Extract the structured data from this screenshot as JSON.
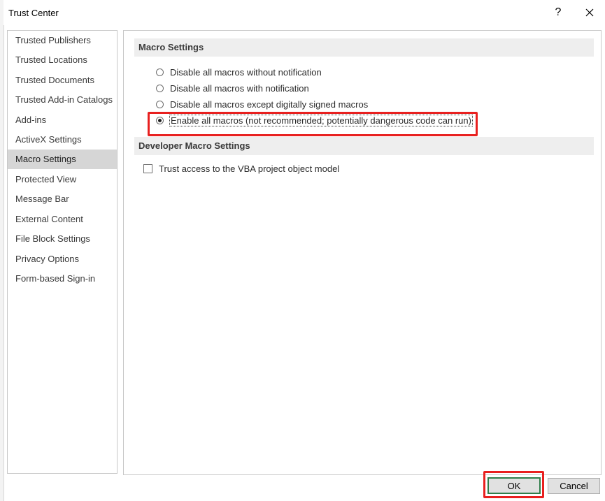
{
  "window": {
    "title": "Trust Center",
    "help_label": "?"
  },
  "sidebar": {
    "items": [
      {
        "label": "Trusted Publishers"
      },
      {
        "label": "Trusted Locations"
      },
      {
        "label": "Trusted Documents"
      },
      {
        "label": "Trusted Add-in Catalogs"
      },
      {
        "label": "Add-ins"
      },
      {
        "label": "ActiveX Settings"
      },
      {
        "label": "Macro Settings"
      },
      {
        "label": "Protected View"
      },
      {
        "label": "Message Bar"
      },
      {
        "label": "External Content"
      },
      {
        "label": "File Block Settings"
      },
      {
        "label": "Privacy Options"
      },
      {
        "label": "Form-based Sign-in"
      }
    ],
    "active_item": "Macro Settings"
  },
  "macro_settings": {
    "header": "Macro Settings",
    "options": [
      {
        "label": "Disable all macros without notification",
        "checked": false
      },
      {
        "label": "Disable all macros with notification",
        "checked": false
      },
      {
        "label": "Disable all macros except digitally signed macros",
        "checked": false
      },
      {
        "label": "Enable all macros (not recommended; potentially dangerous code can run)",
        "checked": true
      }
    ]
  },
  "developer_macro_settings": {
    "header": "Developer Macro Settings",
    "trust_vba_label": "Trust access to the VBA project object model",
    "trust_vba_checked": false
  },
  "footer": {
    "ok_label": "OK",
    "cancel_label": "Cancel"
  },
  "colors": {
    "highlight": "#e8201f",
    "ok_border": "#2f7d4a",
    "active_item_bg": "#d6d6d6",
    "section_bg": "#eeeeee"
  }
}
